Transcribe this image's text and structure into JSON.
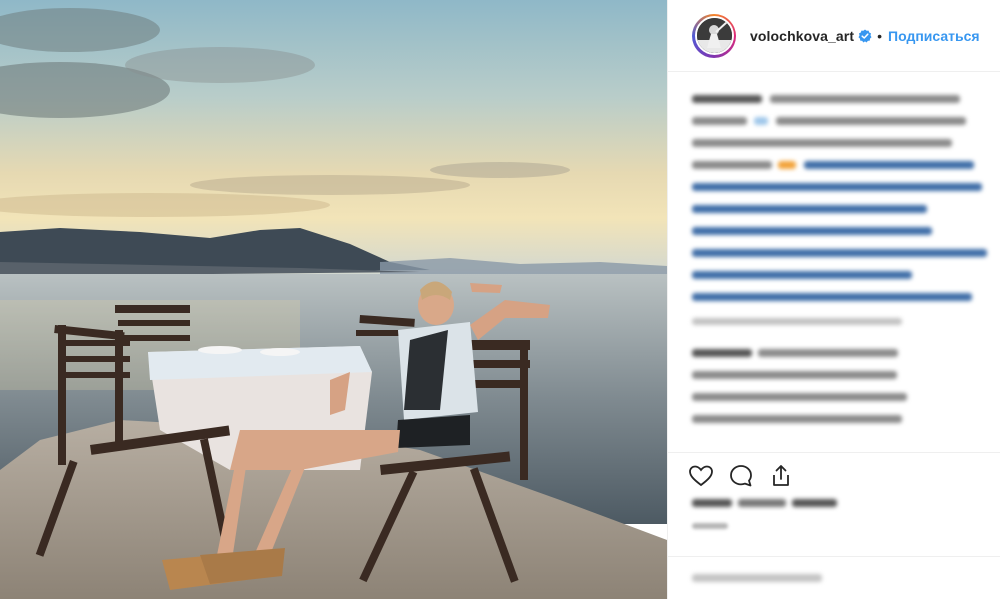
{
  "header": {
    "username": "volochkova_art",
    "separator": "•",
    "follow_label": "Подписаться"
  },
  "photo": {
    "alt": ""
  },
  "icons": {
    "verified": "verified-badge-icon",
    "like": "heart-icon",
    "comment": "comment-icon",
    "share": "share-icon"
  },
  "colors": {
    "accent": "#3897f0",
    "text": "#262626",
    "muted": "#999999",
    "border": "#efefef"
  }
}
